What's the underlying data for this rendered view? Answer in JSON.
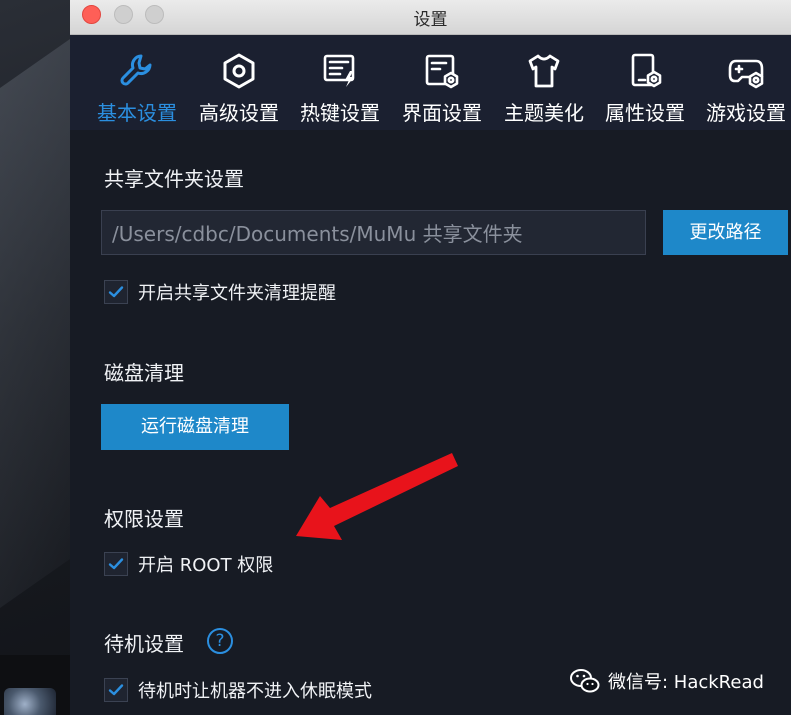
{
  "window": {
    "title": "设置"
  },
  "tabs": [
    {
      "label": "基本设置",
      "icon": "wrench-icon",
      "active": true
    },
    {
      "label": "高级设置",
      "icon": "hexagon-icon",
      "active": false
    },
    {
      "label": "热键设置",
      "icon": "keyboard-icon",
      "active": false
    },
    {
      "label": "界面设置",
      "icon": "screen-gear-icon",
      "active": false
    },
    {
      "label": "主题美化",
      "icon": "tshirt-icon",
      "active": false
    },
    {
      "label": "属性设置",
      "icon": "phone-gear-icon",
      "active": false
    },
    {
      "label": "游戏设置",
      "icon": "gamepad-icon",
      "active": false
    }
  ],
  "shared_folder": {
    "title": "共享文件夹设置",
    "path_value": "/Users/cdbc/Documents/MuMu 共享文件夹",
    "change_path_button": "更改路径",
    "cleanup_reminder": {
      "label": "开启共享文件夹清理提醒",
      "checked": true
    }
  },
  "disk_cleanup": {
    "title": "磁盘清理",
    "run_button": "运行磁盘清理"
  },
  "permissions": {
    "title": "权限设置",
    "root": {
      "label": "开启 ROOT 权限",
      "checked": true
    }
  },
  "standby": {
    "title": "待机设置",
    "help_symbol": "?",
    "no_sleep": {
      "label": "待机时让机器不进入休眠模式",
      "checked": true
    }
  },
  "watermark": {
    "text": "微信号: HackRead",
    "icon": "wechat-icon"
  },
  "colors": {
    "accent": "#1e88c9",
    "active_tab": "#2b8fe0",
    "arrow": "#e8131b",
    "background": "#171b24"
  }
}
